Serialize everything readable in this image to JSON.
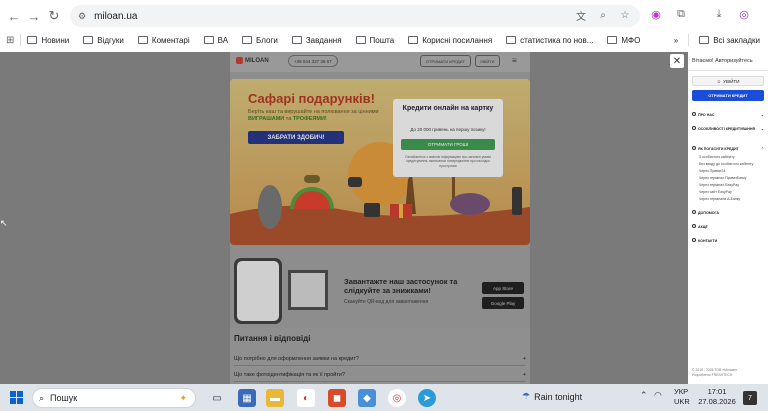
{
  "browser": {
    "url": "miloan.ua",
    "bookmarks": [
      "Новини",
      "Відгуки",
      "Коментарі",
      "ВА",
      "Блоги",
      "Завдання",
      "Пошта",
      "Корисні посилання",
      "статистика по нов...",
      "МФО"
    ],
    "all_bookmarks": "Всі закладки"
  },
  "site": {
    "logo": "MILOAN",
    "phone": "+38 044 337 36 67",
    "get_credit": "ОТРИМАТИ КРЕДИТ",
    "login": "УВІЙТИ",
    "banner": {
      "title": "Сафарі подарунків!",
      "subtitle_pre": "Беріть каш та вирушайте на полювання за цінними ",
      "subtitle_b1": "ВИГРАШАМИ",
      "subtitle_mid": " та ",
      "subtitle_b2": "ТРОФЕЯМИ!",
      "button": "ЗАБРАТИ ЗДОБИЧ!"
    },
    "card": {
      "title": "Кредити онлайн на картку",
      "subtitle": "До 20 000 гривень на першу позику!",
      "button": "ОТРИМАТИ ГРОШІ",
      "note": "Ознайомтеся з повною інформацією про загальні умови кредитування, включаючи попередження про наслідки прострочки"
    },
    "app": {
      "title": "Завантажте наш застосунок та слідкуйте за знижками!",
      "subtitle": "Скануйте QR-код для завантаження",
      "app_store": "App Store",
      "google_play": "Google Play"
    },
    "faq": {
      "title": "Питання і відповіді",
      "items": [
        "Що потрібно для оформлення заявки на кредит?",
        "Що таке фотоідентифікація та як її пройти?"
      ]
    }
  },
  "panel": {
    "title": "Вітаємо! Авторизуйтесь",
    "login": "УВІЙТИ",
    "cta": "ОТРИМАТИ КРЕДИТ",
    "items": [
      "ПРО НАС",
      "ОСОБЛИВОСТІ КРЕДИТУВАННЯ",
      "ЯК ПОГАСИТИ КРЕДИТ",
      "ДОПОМОГА",
      "АКЦІЇ",
      "КОНТАКТИ"
    ],
    "sub_items": [
      "З особистого кабінету",
      "Без входу до особистого кабінету",
      "Через Приват24",
      "Через термінал ПриватБанку",
      "Через термінал EasyPay",
      "Через сайт EasyPay",
      "Через термінали А-Банку"
    ],
    "footer_line1": "© 2015 - 2026 ТОВ «Мілоан»",
    "footer_line2": "Розроблено FRESHTECH"
  },
  "taskbar": {
    "search": "Пошук",
    "weather": "Rain tonight",
    "lang1": "УКР",
    "lang2": "UKR",
    "time": "17:01",
    "date": "27.08.2026",
    "notifications": "7"
  }
}
